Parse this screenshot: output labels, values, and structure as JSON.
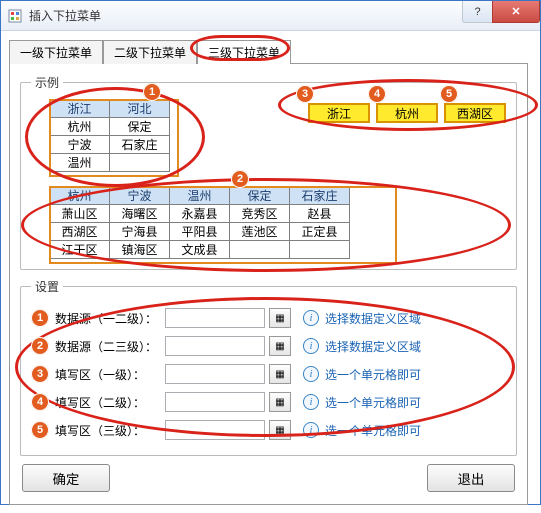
{
  "window": {
    "title": "插入下拉菜单"
  },
  "tabs": [
    {
      "label": "一级下拉菜单"
    },
    {
      "label": "二级下拉菜单"
    },
    {
      "label": "三级下拉菜单"
    }
  ],
  "example_legend": "示例",
  "table1": {
    "headers": [
      "浙江",
      "河北"
    ],
    "rows": [
      [
        "杭州",
        "保定"
      ],
      [
        "宁波",
        "石家庄"
      ],
      [
        "温州",
        ""
      ]
    ]
  },
  "yellow": [
    "浙江",
    "杭州",
    "西湖区"
  ],
  "table2": {
    "headers": [
      "杭州",
      "宁波",
      "温州",
      "保定",
      "石家庄"
    ],
    "rows": [
      [
        "萧山区",
        "海曙区",
        "永嘉县",
        "竞秀区",
        "赵县"
      ],
      [
        "西湖区",
        "宁海县",
        "平阳县",
        "莲池区",
        "正定县"
      ],
      [
        "江干区",
        "镇海区",
        "文成县",
        "",
        ""
      ]
    ]
  },
  "settings_legend": "设置",
  "settings_rows": [
    {
      "n": "1",
      "label": "数据源（一二级）：",
      "hint": "选择数据定义区域"
    },
    {
      "n": "2",
      "label": "数据源（二三级）：",
      "hint": "选择数据定义区域"
    },
    {
      "n": "3",
      "label": "填写区（一级）：",
      "hint": "选一个单元格即可"
    },
    {
      "n": "4",
      "label": "填写区（二级）：",
      "hint": "选一个单元格即可"
    },
    {
      "n": "5",
      "label": "填写区（三级）：",
      "hint": "选一个单元格即可"
    }
  ],
  "buttons": {
    "ok": "确定",
    "exit": "退出"
  },
  "badges": {
    "1": "1",
    "2": "2",
    "3": "3",
    "4": "4",
    "5": "5"
  }
}
